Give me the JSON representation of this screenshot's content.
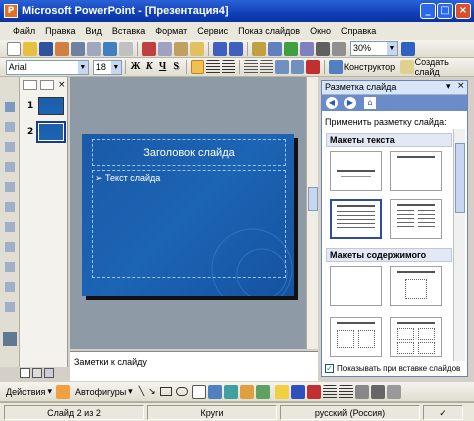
{
  "window": {
    "title": "Microsoft PowerPoint - [Презентация4]"
  },
  "menubar": {
    "items": [
      "Файл",
      "Правка",
      "Вид",
      "Вставка",
      "Формат",
      "Сервис",
      "Показ слайдов",
      "Окно",
      "Справка"
    ]
  },
  "standard_toolbar": {
    "zoom": "30%"
  },
  "format_toolbar": {
    "font": "Arial",
    "size": "18",
    "bold": "Ж",
    "italic": "К",
    "underline": "Ч",
    "shadow": "S",
    "design_label": "Конструктор",
    "new_slide_label": "Создать слайд"
  },
  "slides_pane": {
    "thumb1_number": "1",
    "thumb2_number": "2"
  },
  "slide": {
    "title": "Заголовок слайда",
    "body": "Текст слайда",
    "accent_color": "#1c64b4"
  },
  "notes": {
    "placeholder": "Заметки к слайду"
  },
  "taskpane": {
    "title": "Разметка слайда",
    "apply_label": "Применить разметку слайда:",
    "section_text": "Макеты текста",
    "section_content": "Макеты содержимого",
    "show_on_insert": "Показывать при вставке слайдов"
  },
  "drawing_toolbar": {
    "actions": "Действия",
    "autoshapes": "Автофигуры"
  },
  "statusbar": {
    "slide_info": "Слайд 2 из 2",
    "design": "Круги",
    "language": "русский (Россия)"
  }
}
